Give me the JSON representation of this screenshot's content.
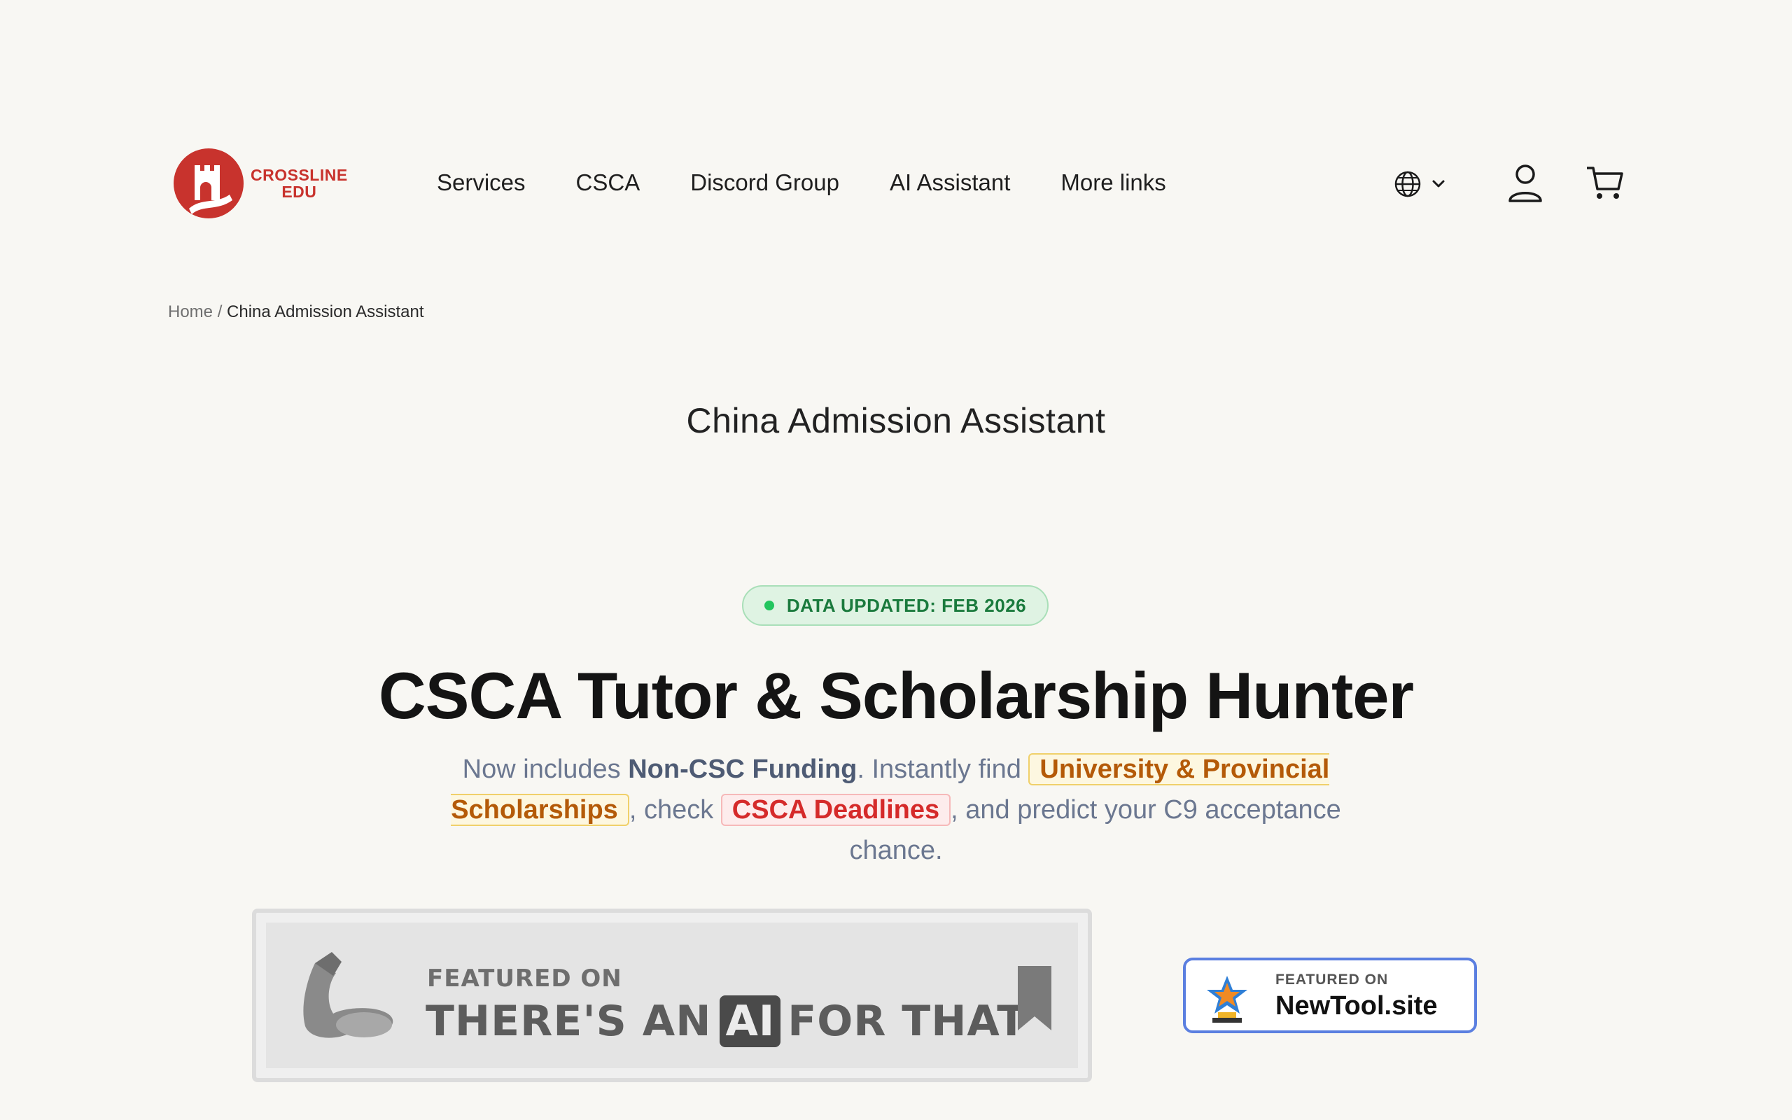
{
  "brand": {
    "line1": "CROSSLINE",
    "line2": "EDU",
    "color": "#c8332d"
  },
  "nav": {
    "items": [
      {
        "label": "Services"
      },
      {
        "label": "CSCA"
      },
      {
        "label": "Discord Group"
      },
      {
        "label": "AI Assistant"
      },
      {
        "label": "More links"
      }
    ]
  },
  "utilities": {
    "language_icon": "globe-icon",
    "account_icon": "user-icon",
    "cart_icon": "cart-icon"
  },
  "breadcrumb": {
    "home": "Home",
    "separator": "/",
    "current": "China Admission Assistant"
  },
  "page_title": "China Admission Assistant",
  "badge": {
    "text": "DATA UPDATED: FEB 2026",
    "dot_color": "#22c55e"
  },
  "hero": {
    "title": "CSCA Tutor & Scholarship Hunter",
    "sub_1": "Now includes ",
    "sub_strong": "Non-CSC Funding",
    "sub_2": ". Instantly find ",
    "sub_hl_1": "University & Provincial Scholarships",
    "sub_3": ", check ",
    "sub_hl_2": "CSCA Deadlines",
    "sub_4": ", and predict your C9 acceptance chance."
  },
  "featured": {
    "aift_small": "FEATURED ON",
    "aift_big_1": "THERE'S AN",
    "aift_big_ai": "AI",
    "aift_big_2": "FOR THAT",
    "newtool_small": "FEATURED ON",
    "newtool_big": "NewTool.site"
  }
}
